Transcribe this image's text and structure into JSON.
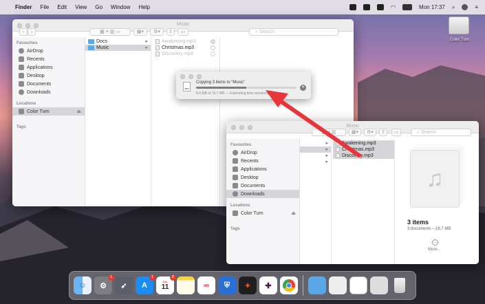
{
  "menubar": {
    "apple": "",
    "app": "Finder",
    "menus": [
      "File",
      "Edit",
      "View",
      "Go",
      "Window",
      "Help"
    ],
    "clock": "Mon 17:37"
  },
  "desktop": {
    "drive_label": "Color Turn"
  },
  "window1": {
    "title": "Music",
    "search_placeholder": "Search",
    "sidebar": {
      "favourites_head": "Favourites",
      "favourites": [
        "AirDrop",
        "Recents",
        "Applications",
        "Desktop",
        "Documents",
        "Downloads"
      ],
      "locations_head": "Locations",
      "locations": [
        "Color Turn"
      ],
      "tags_head": "Tags"
    },
    "col1": [
      "Docs",
      "Music"
    ],
    "col2": [
      "Awakening.mp3",
      "Christmas.mp3",
      "Discovery.mp3"
    ]
  },
  "copy_dialog": {
    "title": "Copying 3 items to “Music”",
    "status": "8.4 MB of 16.7 MB — Estimating time remaining…",
    "progress": 0.5,
    "file_icon_label": "MP3"
  },
  "window2": {
    "title": "Music",
    "search_placeholder": "Search",
    "sidebar": {
      "favourites_head": "Favourites",
      "favourites": [
        "AirDrop",
        "Recents",
        "Applications",
        "Desktop",
        "Documents",
        "Downloads"
      ],
      "locations_head": "Locations",
      "locations": [
        "Color Turn"
      ],
      "tags_head": "Tags"
    },
    "col2": [
      "Awakening.mp3",
      "Christmas.mp3",
      "Discovery.mp3"
    ],
    "preview": {
      "title": "3 items",
      "subtitle": "3 documents – 16,7 MB",
      "more": "More..."
    }
  },
  "dock": {
    "badges": {
      "settings": "1",
      "appstore": "1",
      "calendar": "2"
    },
    "calendar_month": "JUL",
    "calendar_day": "11"
  },
  "colors": {
    "arrow": "#e8353a",
    "folder": "#58a9e8",
    "selection": "#d5d5d9"
  }
}
